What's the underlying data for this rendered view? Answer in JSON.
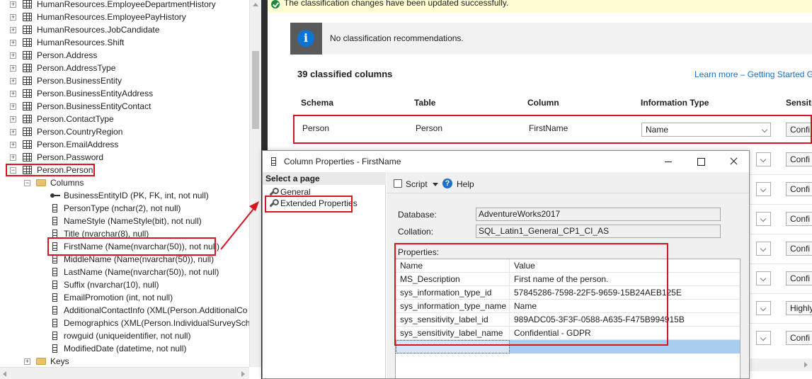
{
  "tree": {
    "tables_above": [
      "HumanResources.EmployeeDepartmentHistory",
      "HumanResources.EmployeePayHistory",
      "HumanResources.JobCandidate",
      "HumanResources.Shift",
      "Person.Address",
      "Person.AddressType",
      "Person.BusinessEntity",
      "Person.BusinessEntityAddress",
      "Person.BusinessEntityContact",
      "Person.ContactType",
      "Person.CountryRegion",
      "Person.EmailAddress",
      "Person.Password"
    ],
    "selected_table": "Person.Person",
    "columns_folder": "Columns",
    "columns": [
      "BusinessEntityID (PK, FK, int, not null)",
      "PersonType (nchar(2), not null)",
      "NameStyle (NameStyle(bit), not null)",
      "Title (nvarchar(8), null)",
      "FirstName (Name(nvarchar(50)), not null)",
      "MiddleName (Name(nvarchar(50)), null)",
      "LastName (Name(nvarchar(50)), not null)",
      "Suffix (nvarchar(10), null)",
      "EmailPromotion (int, not null)",
      "AdditionalContactInfo (XML(Person.AdditionalCo",
      "Demographics (XML(Person.IndividualSurveySche",
      "rowguid (uniqueidentifier, not null)",
      "ModifiedDate (datetime, not null)"
    ],
    "keys_folder": "Keys"
  },
  "classification": {
    "success_message": "The classification changes have been updated successfully.",
    "info_message": "No classification recommendations.",
    "classified_count": "39 classified columns",
    "learn_more": "Learn more – Getting Started Gu",
    "headers": {
      "schema": "Schema",
      "table": "Table",
      "column": "Column",
      "information_type": "Information Type",
      "sensitivity": "Sensiti"
    },
    "first_row": {
      "schema": "Person",
      "table": "Person",
      "column": "FirstName",
      "information_type": "Name",
      "sensitivity": "Confi"
    },
    "other_sensitivity_labels": [
      "Confi",
      "Confi",
      "Confi",
      "Confi",
      "Confi",
      "Highly",
      "Confi"
    ]
  },
  "dialog": {
    "title": "Column Properties - FirstName",
    "select_page": "Select a page",
    "pages": [
      "General",
      "Extended Properties"
    ],
    "toolbar": {
      "script": "Script",
      "help": "Help"
    },
    "database_label": "Database:",
    "database_value": "AdventureWorks2017",
    "collation_label": "Collation:",
    "collation_value": "SQL_Latin1_General_CP1_CI_AS",
    "properties_label": "Properties:",
    "grid_headers": {
      "name": "Name",
      "value": "Value"
    },
    "properties": [
      {
        "name": "MS_Description",
        "value": "First name of the person."
      },
      {
        "name": "sys_information_type_id",
        "value": "57845286-7598-22F5-9659-15B24AEB125E"
      },
      {
        "name": "sys_information_type_name",
        "value": "Name"
      },
      {
        "name": "sys_sensitivity_label_id",
        "value": "989ADC05-3F3F-0588-A635-F475B994915B"
      },
      {
        "name": "sys_sensitivity_label_name",
        "value": "Confidential - GDPR"
      }
    ]
  },
  "colors": {
    "highlight_red": "#d8141e",
    "success_green": "#1c8a3c",
    "info_blue": "#0b74d5",
    "link_blue": "#1a6fc0",
    "splitter_dark": "#2d2d30"
  },
  "icons": [
    "table-icon",
    "column-icon",
    "key-icon",
    "folder-icon",
    "expand-icon",
    "collapse-icon",
    "success-check-icon",
    "info-icon",
    "wrench-icon",
    "script-icon",
    "help-icon"
  ]
}
